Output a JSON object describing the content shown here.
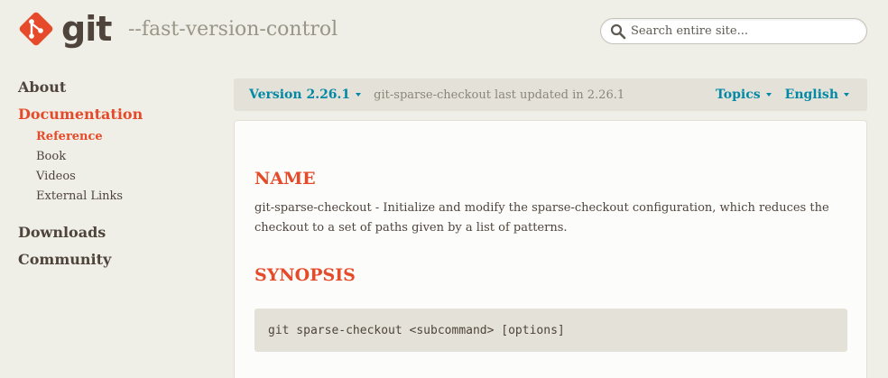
{
  "brand": {
    "name": "git",
    "tagline": "--fast-version-control",
    "accent_color": "#e54b2a",
    "link_color": "#0388a6"
  },
  "search": {
    "icon": "search-icon",
    "placeholder": "Search entire site..."
  },
  "sidebar": {
    "about": "About",
    "documentation": "Documentation",
    "documentation_sub": {
      "reference": "Reference",
      "book": "Book",
      "videos": "Videos",
      "external_links": "External Links"
    },
    "downloads": "Downloads",
    "community": "Community"
  },
  "version_bar": {
    "version_label": "Version 2.26.1",
    "updated_text": "git-sparse-checkout last updated in 2.26.1",
    "topics_label": "Topics",
    "language_label": "English"
  },
  "content": {
    "name_heading": "NAME",
    "name_description": "git-sparse-checkout - Initialize and modify the sparse-checkout configuration, which reduces the checkout to a set of paths given by a list of patterns.",
    "synopsis_heading": "SYNOPSIS",
    "synopsis_code": "git sparse-checkout <subcommand> [options]"
  }
}
